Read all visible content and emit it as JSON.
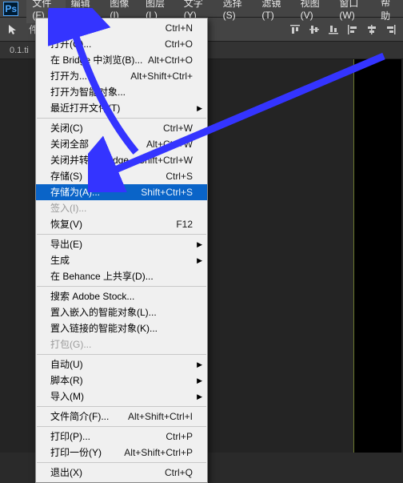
{
  "logo": "Ps",
  "menubar": [
    "文件(F)",
    "编辑(E)",
    "图像(I)",
    "图层(L)",
    "文字(Y)",
    "选择(S)",
    "滤镜(T)",
    "视图(V)",
    "窗口(W)",
    "帮助"
  ],
  "toolbar": {
    "select_label": "件"
  },
  "tab": {
    "label": "0.1.ti"
  },
  "dropdown": {
    "groups": [
      [
        {
          "label": "新建",
          "shortcut": "Ctrl+N",
          "disabled": false
        },
        {
          "label": "打开(O)...",
          "shortcut": "Ctrl+O",
          "disabled": false
        },
        {
          "label": "在 Bridge 中浏览(B)...",
          "shortcut": "Alt+Ctrl+O",
          "disabled": false
        },
        {
          "label": "打开为...",
          "shortcut": "Alt+Shift+Ctrl+",
          "disabled": false
        },
        {
          "label": "打开为智能对象...",
          "shortcut": "",
          "disabled": false
        },
        {
          "label": "最近打开文件(T)",
          "shortcut": "",
          "disabled": false,
          "submenu": true
        }
      ],
      [
        {
          "label": "关闭(C)",
          "shortcut": "Ctrl+W",
          "disabled": false
        },
        {
          "label": "关闭全部",
          "shortcut": "Alt+Ctrl+W",
          "disabled": false
        },
        {
          "label": "关闭并转到 Bridge",
          "shortcut": "Shift+Ctrl+W",
          "disabled": false
        },
        {
          "label": "存储(S)",
          "shortcut": "Ctrl+S",
          "disabled": false
        },
        {
          "label": "存储为(A)...",
          "shortcut": "Shift+Ctrl+S",
          "disabled": false,
          "highlight": true
        },
        {
          "label": "签入(I)...",
          "shortcut": "",
          "disabled": true
        },
        {
          "label": "恢复(V)",
          "shortcut": "F12",
          "disabled": false
        }
      ],
      [
        {
          "label": "导出(E)",
          "shortcut": "",
          "disabled": false,
          "submenu": true
        },
        {
          "label": "生成",
          "shortcut": "",
          "disabled": false,
          "submenu": true
        },
        {
          "label": "在 Behance 上共享(D)...",
          "shortcut": "",
          "disabled": false
        }
      ],
      [
        {
          "label": "搜索 Adobe Stock...",
          "shortcut": "",
          "disabled": false
        },
        {
          "label": "置入嵌入的智能对象(L)...",
          "shortcut": "",
          "disabled": false
        },
        {
          "label": "置入链接的智能对象(K)...",
          "shortcut": "",
          "disabled": false
        },
        {
          "label": "打包(G)...",
          "shortcut": "",
          "disabled": true
        }
      ],
      [
        {
          "label": "自动(U)",
          "shortcut": "",
          "disabled": false,
          "submenu": true
        },
        {
          "label": "脚本(R)",
          "shortcut": "",
          "disabled": false,
          "submenu": true
        },
        {
          "label": "导入(M)",
          "shortcut": "",
          "disabled": false,
          "submenu": true
        }
      ],
      [
        {
          "label": "文件简介(F)...",
          "shortcut": "Alt+Shift+Ctrl+I",
          "disabled": false
        }
      ],
      [
        {
          "label": "打印(P)...",
          "shortcut": "Ctrl+P",
          "disabled": false
        },
        {
          "label": "打印一份(Y)",
          "shortcut": "Alt+Shift+Ctrl+P",
          "disabled": false
        }
      ],
      [
        {
          "label": "退出(X)",
          "shortcut": "Ctrl+Q",
          "disabled": false
        }
      ]
    ]
  },
  "watermark": ""
}
